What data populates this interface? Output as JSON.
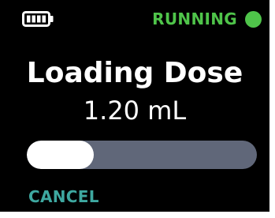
{
  "status": {
    "battery_icon": "battery-full-icon",
    "state_text": "RUNNING",
    "indicator_icon": "status-dot-icon",
    "state_color": "#4fc44a"
  },
  "main": {
    "title": "Loading Dose",
    "dose": "1.20 mL"
  },
  "progress": {
    "fraction": 0.29,
    "fill_color": "#ffffff",
    "track_color": "#606779"
  },
  "actions": {
    "cancel_label": "CANCEL",
    "cancel_color": "#3ea8a0"
  }
}
